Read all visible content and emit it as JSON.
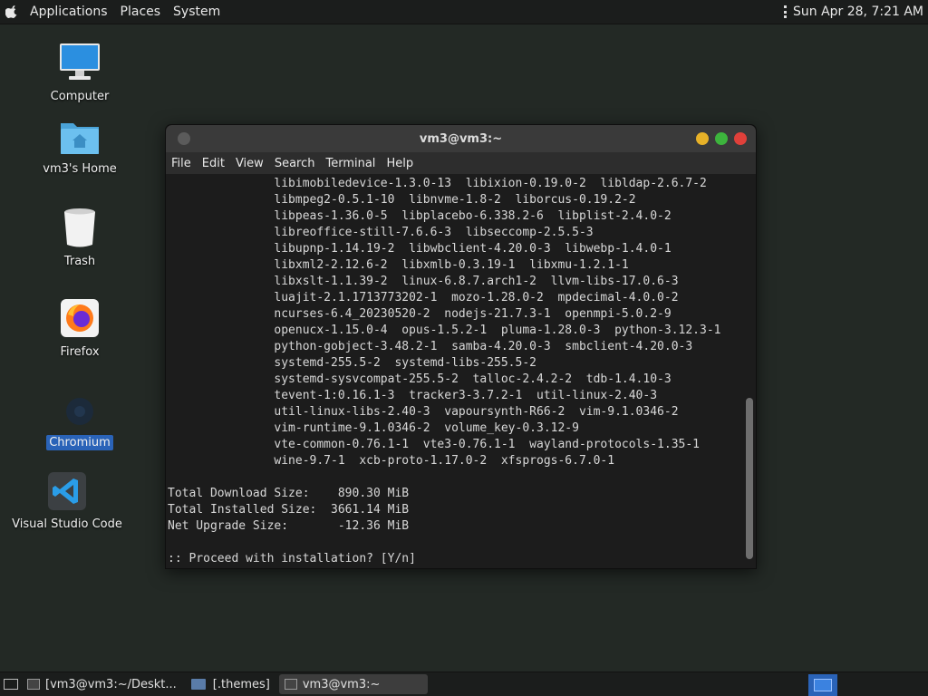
{
  "top_panel": {
    "menus": [
      "Applications",
      "Places",
      "System"
    ],
    "clock": "Sun Apr 28,  7:21 AM"
  },
  "desktop_icons": [
    {
      "label": "Computer",
      "icon": "computer-icon"
    },
    {
      "label": "vm3's Home",
      "icon": "home-folder-icon"
    },
    {
      "label": "Trash",
      "icon": "trash-icon"
    },
    {
      "label": "Firefox",
      "icon": "firefox-icon"
    },
    {
      "label": "Chromium",
      "icon": "chromium-icon",
      "selected": true
    },
    {
      "label": "Visual Studio Code",
      "icon": "vscode-icon"
    }
  ],
  "terminal": {
    "title": "vm3@vm3:~",
    "menu": [
      "File",
      "Edit",
      "View",
      "Search",
      "Terminal",
      "Help"
    ],
    "lines": [
      "               libimobiledevice-1.3.0-13  libixion-0.19.0-2  libldap-2.6.7-2",
      "               libmpeg2-0.5.1-10  libnvme-1.8-2  liborcus-0.19.2-2",
      "               libpeas-1.36.0-5  libplacebo-6.338.2-6  libplist-2.4.0-2",
      "               libreoffice-still-7.6.6-3  libseccomp-2.5.5-3",
      "               libupnp-1.14.19-2  libwbclient-4.20.0-3  libwebp-1.4.0-1",
      "               libxml2-2.12.6-2  libxmlb-0.3.19-1  libxmu-1.2.1-1",
      "               libxslt-1.1.39-2  linux-6.8.7.arch1-2  llvm-libs-17.0.6-3",
      "               luajit-2.1.1713773202-1  mozo-1.28.0-2  mpdecimal-4.0.0-2",
      "               ncurses-6.4_20230520-2  nodejs-21.7.3-1  openmpi-5.0.2-9",
      "               openucx-1.15.0-4  opus-1.5.2-1  pluma-1.28.0-3  python-3.12.3-1",
      "               python-gobject-3.48.2-1  samba-4.20.0-3  smbclient-4.20.0-3",
      "               systemd-255.5-2  systemd-libs-255.5-2",
      "               systemd-sysvcompat-255.5-2  talloc-2.4.2-2  tdb-1.4.10-3",
      "               tevent-1:0.16.1-3  tracker3-3.7.2-1  util-linux-2.40-3",
      "               util-linux-libs-2.40-3  vapoursynth-R66-2  vim-9.1.0346-2",
      "               vim-runtime-9.1.0346-2  volume_key-0.3.12-9",
      "               vte-common-0.76.1-1  vte3-0.76.1-1  wayland-protocols-1.35-1",
      "               wine-9.7-1  xcb-proto-1.17.0-2  xfsprogs-6.7.0-1",
      "",
      "Total Download Size:    890.30 MiB",
      "Total Installed Size:  3661.14 MiB",
      "Net Upgrade Size:       -12.36 MiB",
      "",
      ":: Proceed with installation? [Y/n]"
    ]
  },
  "taskbar": {
    "items": [
      {
        "label": "[vm3@vm3:~/Deskt...",
        "icon": "terminal-icon"
      },
      {
        "label": "[.themes]",
        "icon": "folder-icon"
      },
      {
        "label": "vm3@vm3:~",
        "icon": "terminal-icon",
        "active": true
      }
    ]
  }
}
